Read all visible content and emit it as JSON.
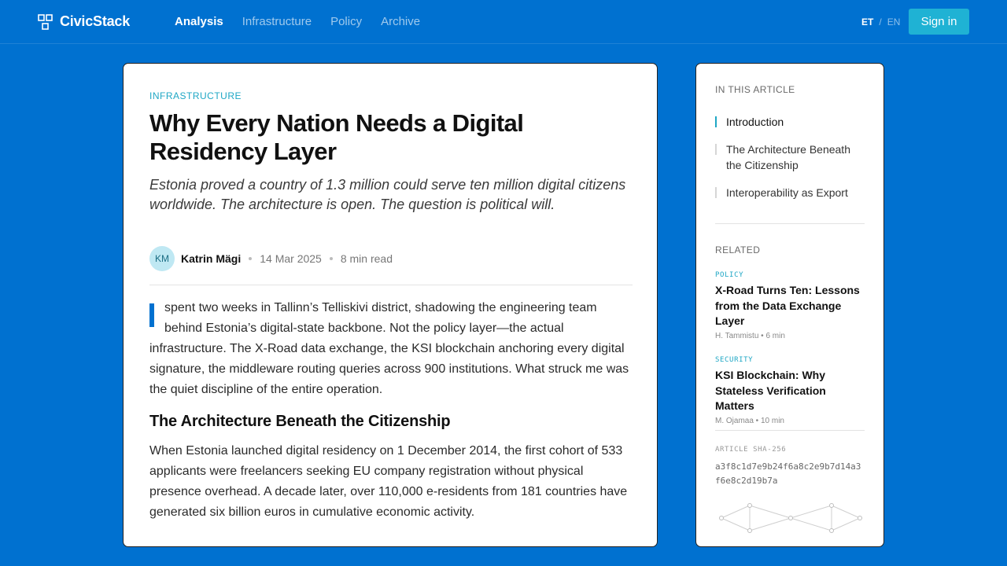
{
  "brand": {
    "name": "CivicStack"
  },
  "nav": {
    "items": [
      {
        "label": "Analysis",
        "active": true
      },
      {
        "label": "Infrastructure"
      },
      {
        "label": "Policy"
      },
      {
        "label": "Archive"
      }
    ]
  },
  "language": {
    "current": "ET",
    "separator": "/",
    "other": "EN"
  },
  "signin_label": "Sign in",
  "article": {
    "kicker": "INFRASTRUCTURE",
    "title": "Why Every Nation Needs a Digital Residency Layer",
    "dek": "Estonia proved a country of 1.3 million could serve ten million digital citizens worldwide. The architecture is open. The question is political will.",
    "author_initials": "KM",
    "author": "Katrin Mägi",
    "date": "14 Mar 2025",
    "read_time": "8 min read",
    "lead_first": "I",
    "lead_text": "spent two weeks in Tallinn’s Telliskivi district, shadowing the engineering team behind Estonia’s digital-state backbone. Not the policy layer—the actual",
    "lead_rest": "infrastructure. The X-Road data exchange, the KSI blockchain anchoring every digital signature, the middleware routing queries across 900 institutions. What struck me was the quiet discipline of the entire operation.",
    "section_heading": "The Architecture Beneath the Citizenship",
    "section_para": "When Estonia launched digital residency on 1 December 2014, the first cohort of 533 applicants were freelancers seeking EU company registration without physical presence overhead. A decade later, over 110,000 e-residents from 181 countries have generated six billion euros in cumulative economic activity."
  },
  "sidebar": {
    "toc_label": "IN THIS ARTICLE",
    "toc": [
      {
        "label": "Introduction",
        "active": true
      },
      {
        "label": "The Architecture Beneath the Citizenship"
      },
      {
        "label": "Interoperability as Export"
      }
    ],
    "related_label": "RELATED",
    "related": [
      {
        "category": "POLICY",
        "title": "X-Road Turns Ten: Lessons from the Data Exchange Layer",
        "author": "H. Tammistu",
        "read_time": "6 min"
      },
      {
        "category": "SECURITY",
        "title": "KSI Blockchain: Why Stateless Verification Matters",
        "author": "M. Ojamaa",
        "read_time": "10 min"
      }
    ],
    "hash_label": "ARTICLE SHA-256",
    "hash": "a3f8c1d7e9b24f6a8c2e9b7d14a3f6e8c2d19b7a"
  },
  "colors": {
    "background": "#0071d0",
    "accent": "#1fb2d4",
    "kicker": "#1fa7c5"
  }
}
